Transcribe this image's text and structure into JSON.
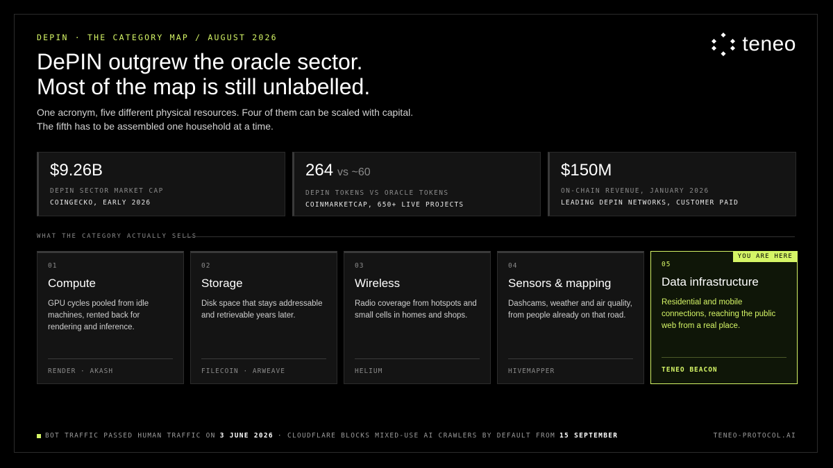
{
  "eyebrow": "DEPIN · THE CATEGORY MAP / AUGUST 2026",
  "logo": {
    "text": "teneo",
    "icon": "teneo-dots-logo-icon"
  },
  "headline": {
    "line1": "DePIN outgrew the oracle sector.",
    "line2": "Most of the map is still unlabelled."
  },
  "subhead": {
    "line1": "One acronym, five different physical resources. Four of them can be scaled with capital.",
    "line2": "The fifth has to be assembled one household at a time."
  },
  "stats": [
    {
      "value": "$9.26B",
      "vs": "",
      "label": "DEPIN SECTOR MARKET CAP",
      "source": "COINGECKO, EARLY 2026"
    },
    {
      "value": "264",
      "vs": "vs ~60",
      "label": "DEPIN TOKENS VS ORACLE TOKENS",
      "source": "COINMARKETCAP, 650+ LIVE PROJECTS"
    },
    {
      "value": "$150M",
      "vs": "",
      "label": "ON-CHAIN REVENUE, JANUARY 2026",
      "source": "LEADING DEPIN NETWORKS, CUSTOMER PAID"
    }
  ],
  "section_label": "WHAT THE CATEGORY ACTUALLY SELLS",
  "cards": [
    {
      "num": "01",
      "title": "Compute",
      "desc": "GPU cycles pooled from idle machines, rented back for rendering and inference.",
      "footer": "RENDER · AKASH"
    },
    {
      "num": "02",
      "title": "Storage",
      "desc": "Disk space that stays addressable and retrievable years later.",
      "footer": "FILECOIN · ARWEAVE"
    },
    {
      "num": "03",
      "title": "Wireless",
      "desc": "Radio coverage from hotspots and small cells in homes and shops.",
      "footer": "HELIUM"
    },
    {
      "num": "04",
      "title": "Sensors & mapping",
      "desc": "Dashcams, weather and air quality, from people already on that road.",
      "footer": "HIVEMAPPER"
    },
    {
      "num": "05",
      "title": "Data infrastructure",
      "desc": "Residential and mobile connections, reaching the public web from a real place.",
      "footer": "TENEO BEACON",
      "badge": "YOU ARE HERE"
    }
  ],
  "footer": {
    "part1": "BOT TRAFFIC PASSED HUMAN TRAFFIC ON",
    "date1": "3 JUNE 2026",
    "part2": "· CLOUDFLARE BLOCKS MIXED-USE AI CRAWLERS BY DEFAULT FROM",
    "date2": "15 SEPTEMBER",
    "url": "TENEO-PROTOCOL.AI"
  },
  "colors": {
    "accent": "#d5f566",
    "background": "#000000",
    "card": "#141414"
  }
}
